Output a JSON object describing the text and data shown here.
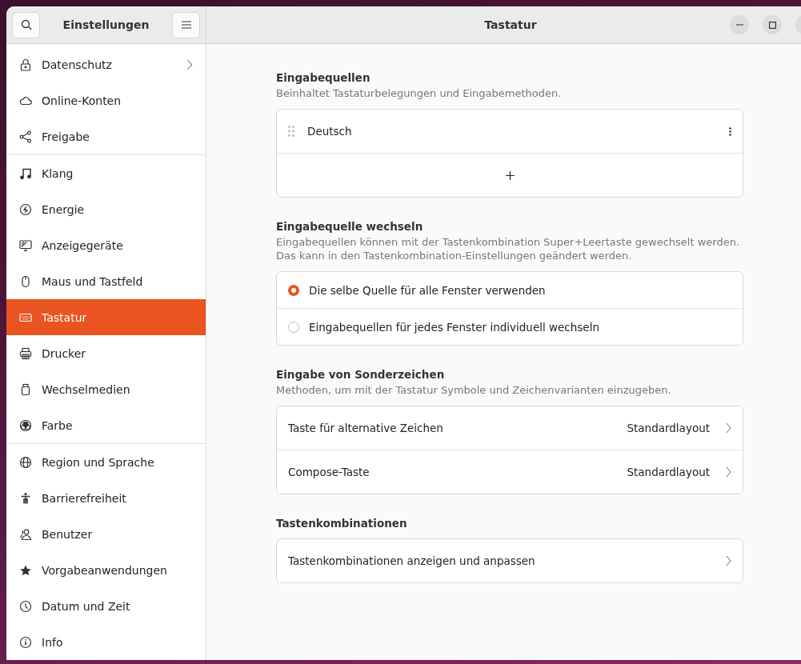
{
  "sidebar": {
    "title": "Einstellungen",
    "groups": [
      [
        {
          "label": "Datenschutz",
          "selected": false,
          "submenu": true
        },
        {
          "label": "Online-Konten",
          "selected": false,
          "submenu": false
        },
        {
          "label": "Freigabe",
          "selected": false,
          "submenu": false
        }
      ],
      [
        {
          "label": "Klang",
          "selected": false,
          "submenu": false
        },
        {
          "label": "Energie",
          "selected": false,
          "submenu": false
        },
        {
          "label": "Anzeigegeräte",
          "selected": false,
          "submenu": false
        },
        {
          "label": "Maus und Tastfeld",
          "selected": false,
          "submenu": false
        },
        {
          "label": "Tastatur",
          "selected": true,
          "submenu": false
        },
        {
          "label": "Drucker",
          "selected": false,
          "submenu": false
        },
        {
          "label": "Wechselmedien",
          "selected": false,
          "submenu": false
        },
        {
          "label": "Farbe",
          "selected": false,
          "submenu": false
        }
      ],
      [
        {
          "label": "Region und Sprache",
          "selected": false,
          "submenu": false
        },
        {
          "label": "Barrierefreiheit",
          "selected": false,
          "submenu": false
        },
        {
          "label": "Benutzer",
          "selected": false,
          "submenu": false
        },
        {
          "label": "Vorgabeanwendungen",
          "selected": false,
          "submenu": false
        },
        {
          "label": "Datum und Zeit",
          "selected": false,
          "submenu": false
        },
        {
          "label": "Info",
          "selected": false,
          "submenu": false
        }
      ]
    ]
  },
  "window": {
    "title": "Tastatur"
  },
  "sections": [
    {
      "kind": "sources",
      "title": "Eingabequellen",
      "description": [
        "Beinhaltet Tastaturbelegungen und Eingabemethoden."
      ],
      "sources": [
        "Deutsch"
      ]
    },
    {
      "kind": "radio",
      "title": "Eingabequelle wechseln",
      "description": [
        "Eingabequellen können mit der Tastenkombination Super+Leertaste gewechselt werden.",
        "Das kann in den Tastenkombination-Einstellungen geändert werden."
      ],
      "options": [
        {
          "label": "Die selbe Quelle für alle Fenster verwenden",
          "selected": true
        },
        {
          "label": "Eingabequellen für jedes Fenster individuell wechseln",
          "selected": false
        }
      ]
    },
    {
      "kind": "links",
      "title": "Eingabe von Sonderzeichen",
      "description": [
        "Methoden, um mit der Tastatur Symbole und Zeichenvarianten einzugeben."
      ],
      "rows": [
        {
          "label": "Taste für alternative Zeichen",
          "value": "Standardlayout"
        },
        {
          "label": "Compose-Taste",
          "value": "Standardlayout"
        }
      ]
    },
    {
      "kind": "links",
      "title": "Tastenkombinationen",
      "rows": [
        {
          "label": "Tastenkombinationen anzeigen und anpassen"
        }
      ]
    }
  ]
}
